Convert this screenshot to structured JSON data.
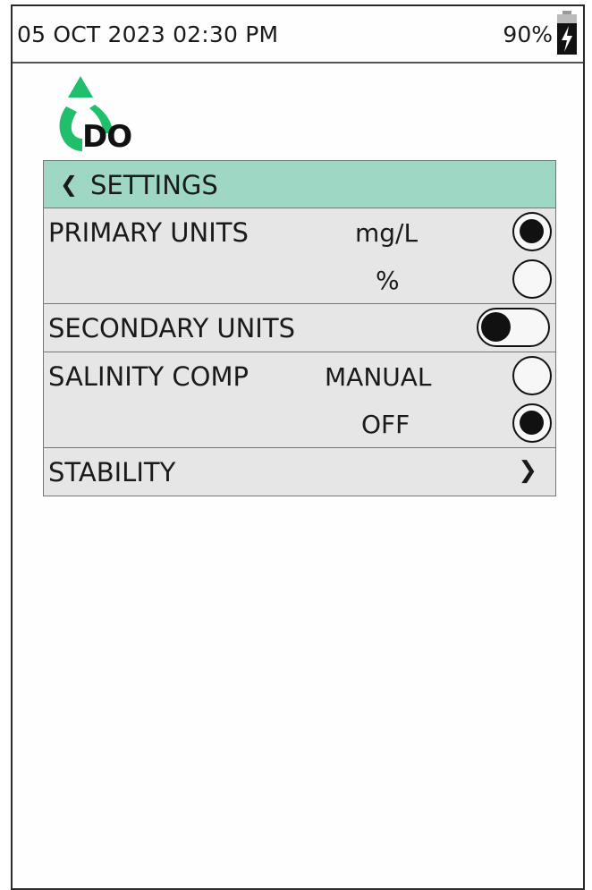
{
  "status": {
    "datetime": "05 OCT 2023 02:30 PM",
    "battery": "90%"
  },
  "logo": {
    "text": "DO",
    "color": "#1fbf6c"
  },
  "menu": {
    "title": "SETTINGS",
    "header_color": "#9ed8c5",
    "primary_units": {
      "label": "PRIMARY UNITS",
      "options": [
        {
          "label": "mg/L",
          "selected": true
        },
        {
          "label": "%",
          "selected": false
        }
      ]
    },
    "secondary_units": {
      "label": "SECONDARY UNITS",
      "toggle_on": false
    },
    "salinity_comp": {
      "label": "SALINITY COMP",
      "options": [
        {
          "label": "MANUAL",
          "selected": false
        },
        {
          "label": "OFF",
          "selected": true
        }
      ]
    },
    "stability": {
      "label": "STABILITY"
    }
  },
  "icons": {
    "back": "chevron-left-icon",
    "forward": "chevron-right-icon",
    "battery": "battery-charging-icon",
    "logo": "do-recycle-logo"
  }
}
